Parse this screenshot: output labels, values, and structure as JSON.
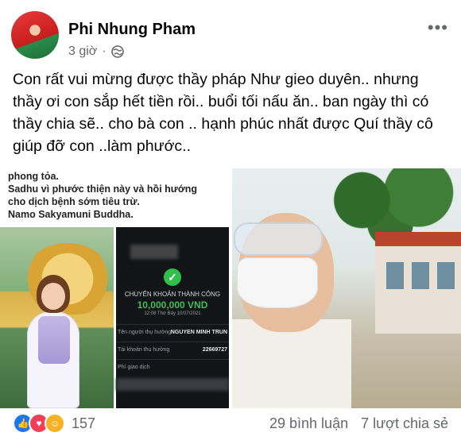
{
  "post": {
    "author": "Phi Nhung Pham",
    "time": "3 giờ",
    "dot": "·",
    "more": "•••",
    "caption": "Con rất vui mừng được thầy pháp Như gieo duyên.. nhưng thầy ơi con sắp hết tiền rồi.. buổi tối nấu ăn.. ban ngày thì có thầy chia sẽ.. cho bà con .. hạnh phúc nhất được Quí thầy cô giúp đỡ con ..làm phước.."
  },
  "left_image": {
    "line1": "phong tỏa.",
    "line2": "Sadhu vì phước thiện này và hồi hướng",
    "line3": "cho dịch bệnh sớm tiêu trừ.",
    "line4": "Namo Sakyamuni Buddha."
  },
  "phone": {
    "status": "CHUYỂN KHOẢN THÀNH CÔNG",
    "amount": "10,000,000 VND",
    "date": "12:08 Thứ Bảy 10/07/2021",
    "row1_label": "Tên người thụ hưởng",
    "row1_value": "NGUYEN MINH TRUN",
    "row2_label": "Tài khoản thụ hưởng",
    "row2_value": "22669727",
    "row3_label": "Phí giao dịch"
  },
  "footer": {
    "reaction_count": "157",
    "comments": "29 bình luận",
    "shares": "7 lượt chia sẻ"
  },
  "colors": {
    "like": "#1877f2",
    "love": "#f33e58",
    "care": "#f7b125",
    "success_green": "#39c15a"
  }
}
